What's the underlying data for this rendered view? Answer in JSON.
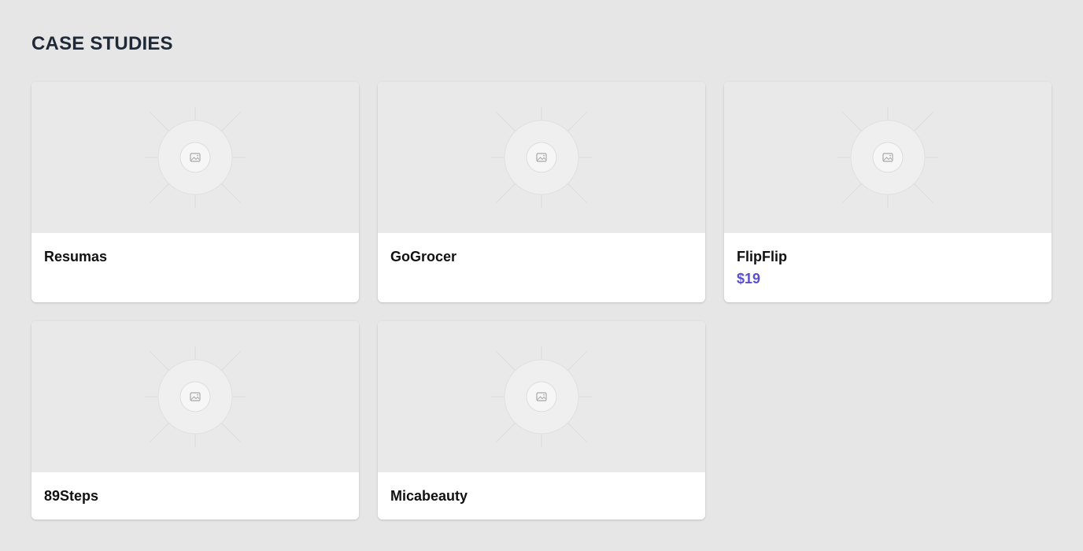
{
  "section": {
    "title": "CASE STUDIES"
  },
  "cards": [
    {
      "title": "Resumas",
      "price": ""
    },
    {
      "title": "GoGrocer",
      "price": ""
    },
    {
      "title": "FlipFlip",
      "price": "$19"
    },
    {
      "title": "89Steps",
      "price": ""
    },
    {
      "title": "Micabeauty",
      "price": ""
    }
  ],
  "colors": {
    "background": "#e6e6e6",
    "card": "#ffffff",
    "placeholder": "#e9e9e9",
    "title": "#1f2937",
    "price": "#5b4fcf"
  },
  "icons": {
    "placeholder": "image-placeholder-icon"
  }
}
